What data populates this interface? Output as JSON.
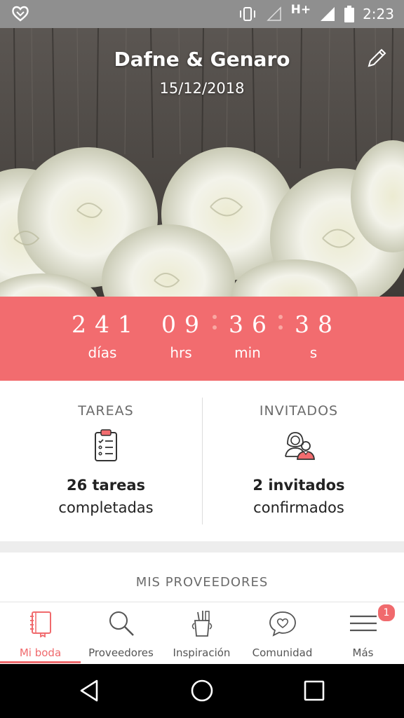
{
  "status_bar": {
    "time": "2:23",
    "network": "H+",
    "icons": [
      "heart-app-icon",
      "vibrate-icon",
      "signal-empty-icon",
      "signal-full-icon",
      "battery-icon"
    ]
  },
  "header": {
    "couple_names": "Dafne & Genaro",
    "wedding_date": "15/12/2018",
    "edit_icon": "pencil-icon"
  },
  "countdown": {
    "days": "241",
    "hours": "09",
    "minutes": "36",
    "seconds": "38",
    "labels": {
      "days": "días",
      "hours": "hrs",
      "minutes": "min",
      "seconds": "s"
    }
  },
  "stats": {
    "tasks": {
      "title": "TAREAS",
      "count": "26 tareas",
      "sub": "completadas",
      "icon": "clipboard-checklist-icon"
    },
    "guests": {
      "title": "INVITADOS",
      "count": "2 invitados",
      "sub": "confirmados",
      "icon": "couple-icon"
    }
  },
  "providers": {
    "title": "MIS PROVEEDORES"
  },
  "bottom_nav": {
    "items": [
      {
        "label": "Mi boda",
        "icon": "notebook-icon",
        "active": true
      },
      {
        "label": "Proveedores",
        "icon": "search-icon",
        "active": false
      },
      {
        "label": "Inspiración",
        "icon": "craft-cup-icon",
        "active": false
      },
      {
        "label": "Comunidad",
        "icon": "chat-heart-icon",
        "active": false
      },
      {
        "label": "Más",
        "icon": "menu-icon",
        "active": false
      }
    ],
    "badge_count": "1"
  },
  "colors": {
    "accent": "#f26c6f",
    "status_bar": "#8f8f8f",
    "divider": "#ededed"
  }
}
